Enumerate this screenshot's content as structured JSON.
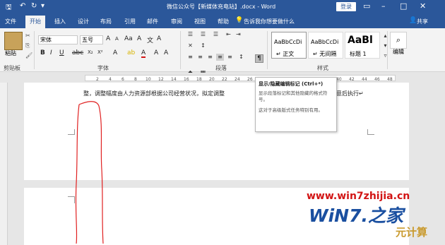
{
  "titlebar": {
    "doc_title": "微信公众号【新媒体充电站】.docx - Word",
    "login_label": "登录"
  },
  "tabs": [
    "文件",
    "开始",
    "插入",
    "设计",
    "布局",
    "引用",
    "邮件",
    "审阅",
    "视图",
    "帮助"
  ],
  "tellme": "告诉我你想要做什么",
  "share": "共享",
  "ribbon": {
    "paste_label": "粘贴",
    "clipboard_label": "剪贴板",
    "font_name": "宋体",
    "font_size": "五号",
    "font_group_label": "字体",
    "paragraph_group_label": "段落",
    "styles_group_label": "样式",
    "edit_label": "编辑",
    "styles": [
      {
        "sample": "AaBbCcDi",
        "name": "↵ 正文"
      },
      {
        "sample": "AaBbCcDi",
        "name": "↵ 无间隔"
      },
      {
        "sample": "AaBl",
        "name": "标题 1"
      }
    ]
  },
  "document": {
    "line1": "整，调整幅度由人力资源部根据公司经营状况，拟定调整"
  },
  "tooltip": {
    "title": "显示/隐藏编辑标记 (Ctrl+*)",
    "desc": "显示段落标记和其他隐藏的格式符号。",
    "note": "这对于高级版式任务特别有用。"
  },
  "watermark": {
    "url": "www.win7zhijia.cn",
    "logo": "WiN7.之家",
    "site": "元计算"
  },
  "doc_tail": "意后执行↵",
  "ruler_numbers": [
    "2",
    "4",
    "6",
    "8",
    "10",
    "12",
    "14",
    "16",
    "18",
    "20",
    "22",
    "24",
    "26",
    "28",
    "30",
    "32",
    "34",
    "36",
    "38",
    "40",
    "42",
    "44",
    "46",
    "48"
  ]
}
